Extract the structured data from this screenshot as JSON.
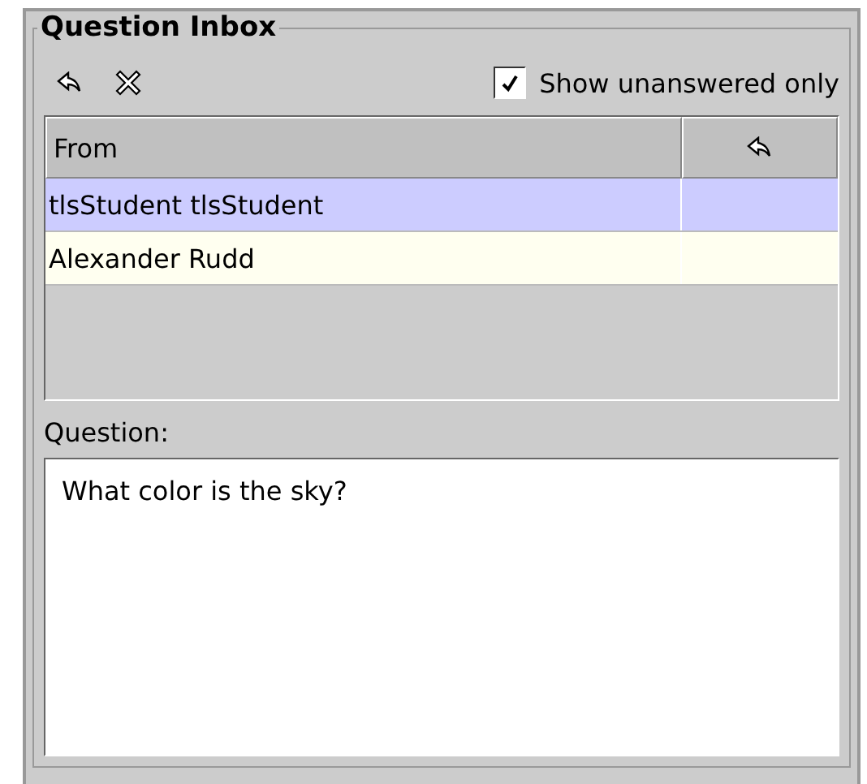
{
  "panel": {
    "title": "Question Inbox"
  },
  "toolbar": {
    "show_unanswered_only": {
      "label": "Show unanswered only",
      "checked": true
    }
  },
  "table": {
    "columns": [
      {
        "label": "From"
      }
    ],
    "rows": [
      {
        "from": "tlsStudent tlsStudent",
        "selected": true
      },
      {
        "from": "Alexander Rudd",
        "selected": false
      }
    ]
  },
  "question": {
    "label": "Question:",
    "value": "What color is the sky?"
  }
}
